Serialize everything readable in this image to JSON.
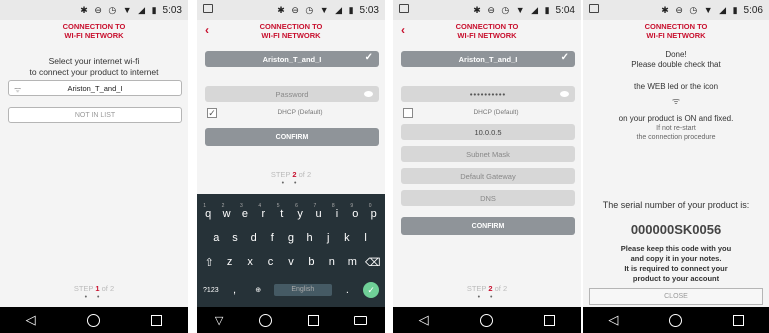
{
  "header": {
    "title": "CONNECTION TO\nWI-FI NETWORK"
  },
  "screens": [
    {
      "time": "5:03",
      "intro_line1": "Select your internet wi-fi",
      "intro_line2": "to connect your product to internet",
      "network": "Ariston_T_and_I",
      "not_in_list": "NOT IN LIST",
      "step_word": "STEP",
      "step_current": "1",
      "step_total": "of 2"
    },
    {
      "time": "5:03",
      "network": "Ariston_T_and_I",
      "password_placeholder": "Password",
      "dhcp_label": "DHCP (Default)",
      "confirm": "CONFIRM",
      "step_word": "STEP",
      "step_current": "2",
      "step_total": "of 2",
      "keyboard": {
        "row1": [
          "q",
          "w",
          "e",
          "r",
          "t",
          "y",
          "u",
          "i",
          "o",
          "p"
        ],
        "row1_nums": [
          "1",
          "2",
          "3",
          "4",
          "5",
          "6",
          "7",
          "8",
          "9",
          "0"
        ],
        "row2": [
          "a",
          "s",
          "d",
          "f",
          "g",
          "h",
          "j",
          "k",
          "l"
        ],
        "row3": [
          "z",
          "x",
          "c",
          "v",
          "b",
          "n",
          "m"
        ],
        "symbols_key": "?123",
        "comma_key": ",",
        "space_label": "English",
        "period_key": "."
      }
    },
    {
      "time": "5:04",
      "network": "Ariston_T_and_I",
      "password_value": "••••••••••",
      "dhcp_label": "DHCP (Default)",
      "ip_value": "10.0.0.5",
      "subnet_placeholder": "Subnet Mask",
      "gateway_placeholder": "Default Gateway",
      "dns_placeholder": "DNS",
      "confirm": "CONFIRM",
      "step_word": "STEP",
      "step_current": "2",
      "step_total": "of 2"
    },
    {
      "time": "5:06",
      "done": "Done!",
      "check_line": "Please double check that",
      "web_line": "the WEB led or the icon",
      "on_line": "on your product is ON and fixed.",
      "if_not": "If not re-start",
      "procedure": "the connection procedure",
      "serial_title": "The serial number of your product is:",
      "serial_value": "000000SK0056",
      "keep_line1": "Please keep this code with you",
      "keep_line2": "and copy it in your notes.",
      "req_line1": "It is required to connect your",
      "req_line2": "product to your account",
      "close": "CLOSE"
    }
  ],
  "colors": {
    "brand": "#c8102e",
    "button_grey": "#8f9499",
    "nav": "#000000",
    "keyboard": "#263238"
  }
}
